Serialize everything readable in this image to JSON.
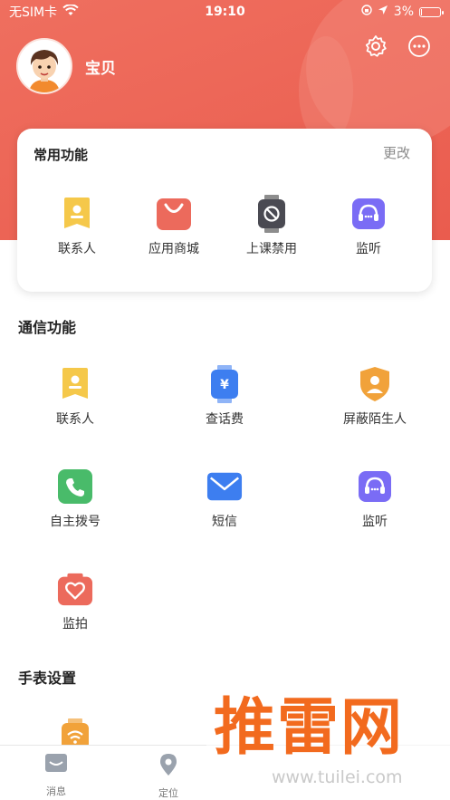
{
  "status_bar": {
    "carrier": "无SIM卡",
    "time": "19:10",
    "battery": "3%",
    "battery_level": 0.03
  },
  "profile": {
    "name": "宝贝"
  },
  "common": {
    "title": "常用功能",
    "edit": "更改",
    "items": [
      {
        "label": "联系人",
        "icon": "contacts-icon"
      },
      {
        "label": "应用商城",
        "icon": "app-store-icon"
      },
      {
        "label": "上课禁用",
        "icon": "class-disable-icon"
      },
      {
        "label": "监听",
        "icon": "monitor-listen-icon"
      }
    ]
  },
  "communication": {
    "title": "通信功能",
    "items": [
      {
        "label": "联系人",
        "icon": "contacts-icon"
      },
      {
        "label": "查话费",
        "icon": "phone-bill-icon"
      },
      {
        "label": "屏蔽陌生人",
        "icon": "block-strangers-icon"
      },
      {
        "label": "自主拨号",
        "icon": "dial-icon"
      },
      {
        "label": "短信",
        "icon": "sms-icon"
      },
      {
        "label": "监听",
        "icon": "monitor-listen-icon"
      },
      {
        "label": "监拍",
        "icon": "remote-photo-icon"
      }
    ]
  },
  "watch_settings": {
    "title": "手表设置"
  },
  "tabbar": {
    "items": [
      {
        "label": "消息",
        "icon": "message-icon"
      },
      {
        "label": "定位",
        "icon": "location-icon"
      }
    ]
  },
  "watermark": {
    "brand": "推雷网",
    "url": "www.tuilei.com"
  },
  "colors": {
    "header": "#ea5c4e",
    "contacts": "#f5c84a",
    "store": "#ec6a5c",
    "shield": "#f1a23a",
    "dial": "#49bb6a",
    "sms": "#3d7ef0",
    "listen": "#7a6cf5"
  }
}
